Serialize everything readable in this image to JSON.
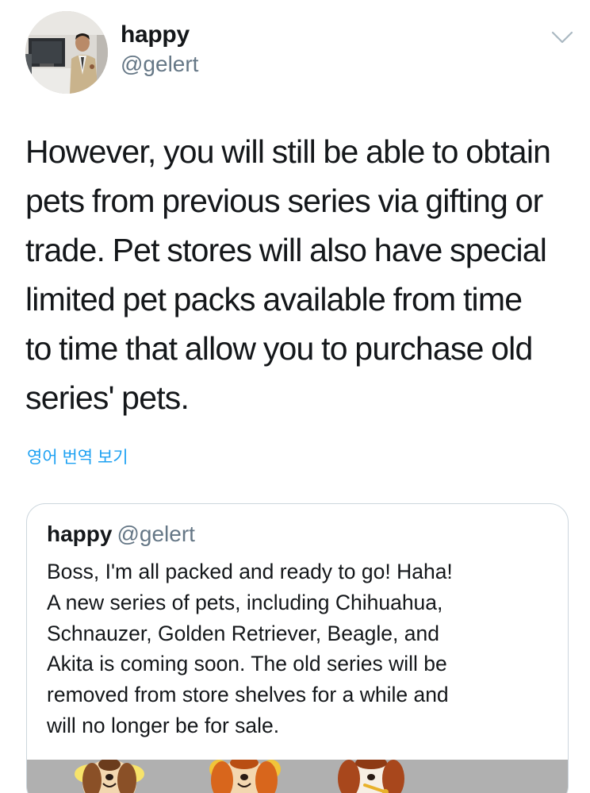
{
  "author": {
    "display_name": "happy",
    "handle": "@gelert"
  },
  "tweet": {
    "text": "However, you will still be able to obtain\npets from previous series via gifting or\ntrade. Pet stores will also have special\nlimited pet packs available from time\nto time that allow you to purchase old\nseries' pets.",
    "translate_link": "영어 번역 보기"
  },
  "quoted_tweet": {
    "display_name": "happy",
    "handle": "@gelert",
    "text": "Boss, I'm all packed and ready to go! Haha!\nA new series of pets, including Chihuahua,\nSchnauzer, Golden Retriever, Beagle, and\nAkita is coming soon. The old series will be\nremoved from store shelves for a while and\nwill no longer be for sale."
  },
  "icons": {
    "menu": "chevron-down-icon",
    "avatar": "user-avatar-photo"
  },
  "colors": {
    "text_primary": "#14171a",
    "text_secondary": "#657786",
    "link": "#1da1f2",
    "card_border": "#ccd6dd"
  }
}
